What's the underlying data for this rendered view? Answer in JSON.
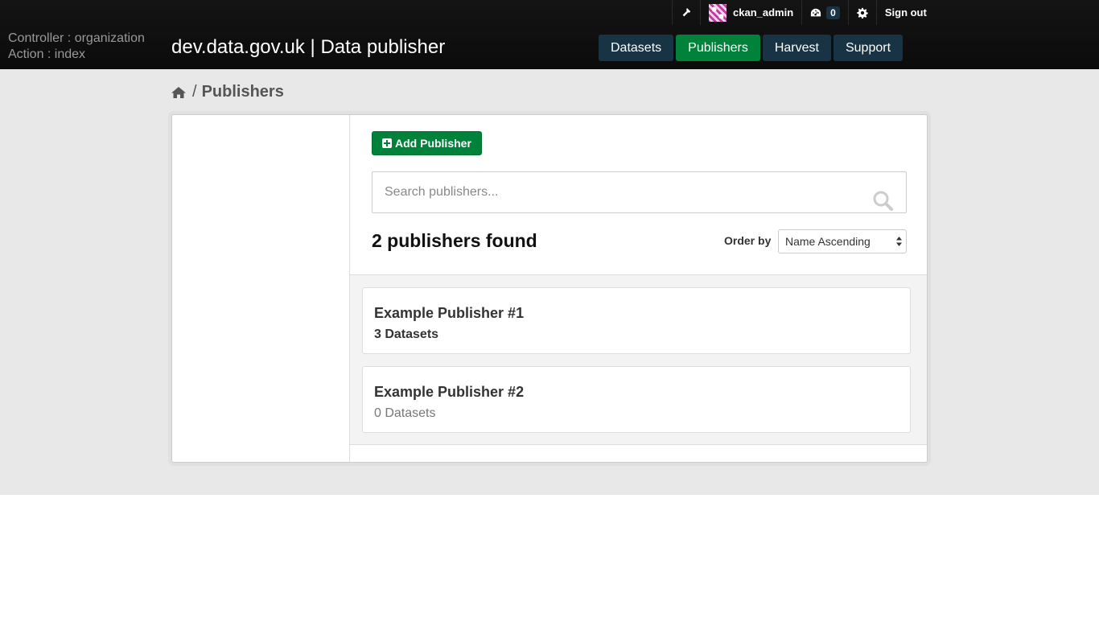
{
  "account": {
    "username": "ckan_admin",
    "activity_count": "0",
    "sign_out": "Sign out"
  },
  "debug": {
    "controller": "Controller : organization",
    "action": "Action : index"
  },
  "site_title": "dev.data.gov.uk | Data publisher",
  "nav": {
    "items": [
      {
        "label": "Datasets"
      },
      {
        "label": "Publishers"
      },
      {
        "label": "Harvest"
      },
      {
        "label": "Support"
      }
    ],
    "active": "Publishers"
  },
  "breadcrumb": {
    "separator": "/",
    "current": "Publishers"
  },
  "actions": {
    "add_publisher": "Add Publisher"
  },
  "search": {
    "placeholder": "Search publishers...",
    "value": ""
  },
  "results": {
    "count_text": "2 publishers found",
    "order_label": "Order by",
    "order_selected": "Name Ascending"
  },
  "publishers": [
    {
      "name": "Example Publisher #1",
      "datasets": "3 Datasets"
    },
    {
      "name": "Example Publisher #2",
      "datasets": "0 Datasets"
    }
  ],
  "colors": {
    "header_bg": "#111111",
    "nav_bg": "#183344",
    "accent_green": "#00823b",
    "page_bg": "#e8e8e8"
  }
}
